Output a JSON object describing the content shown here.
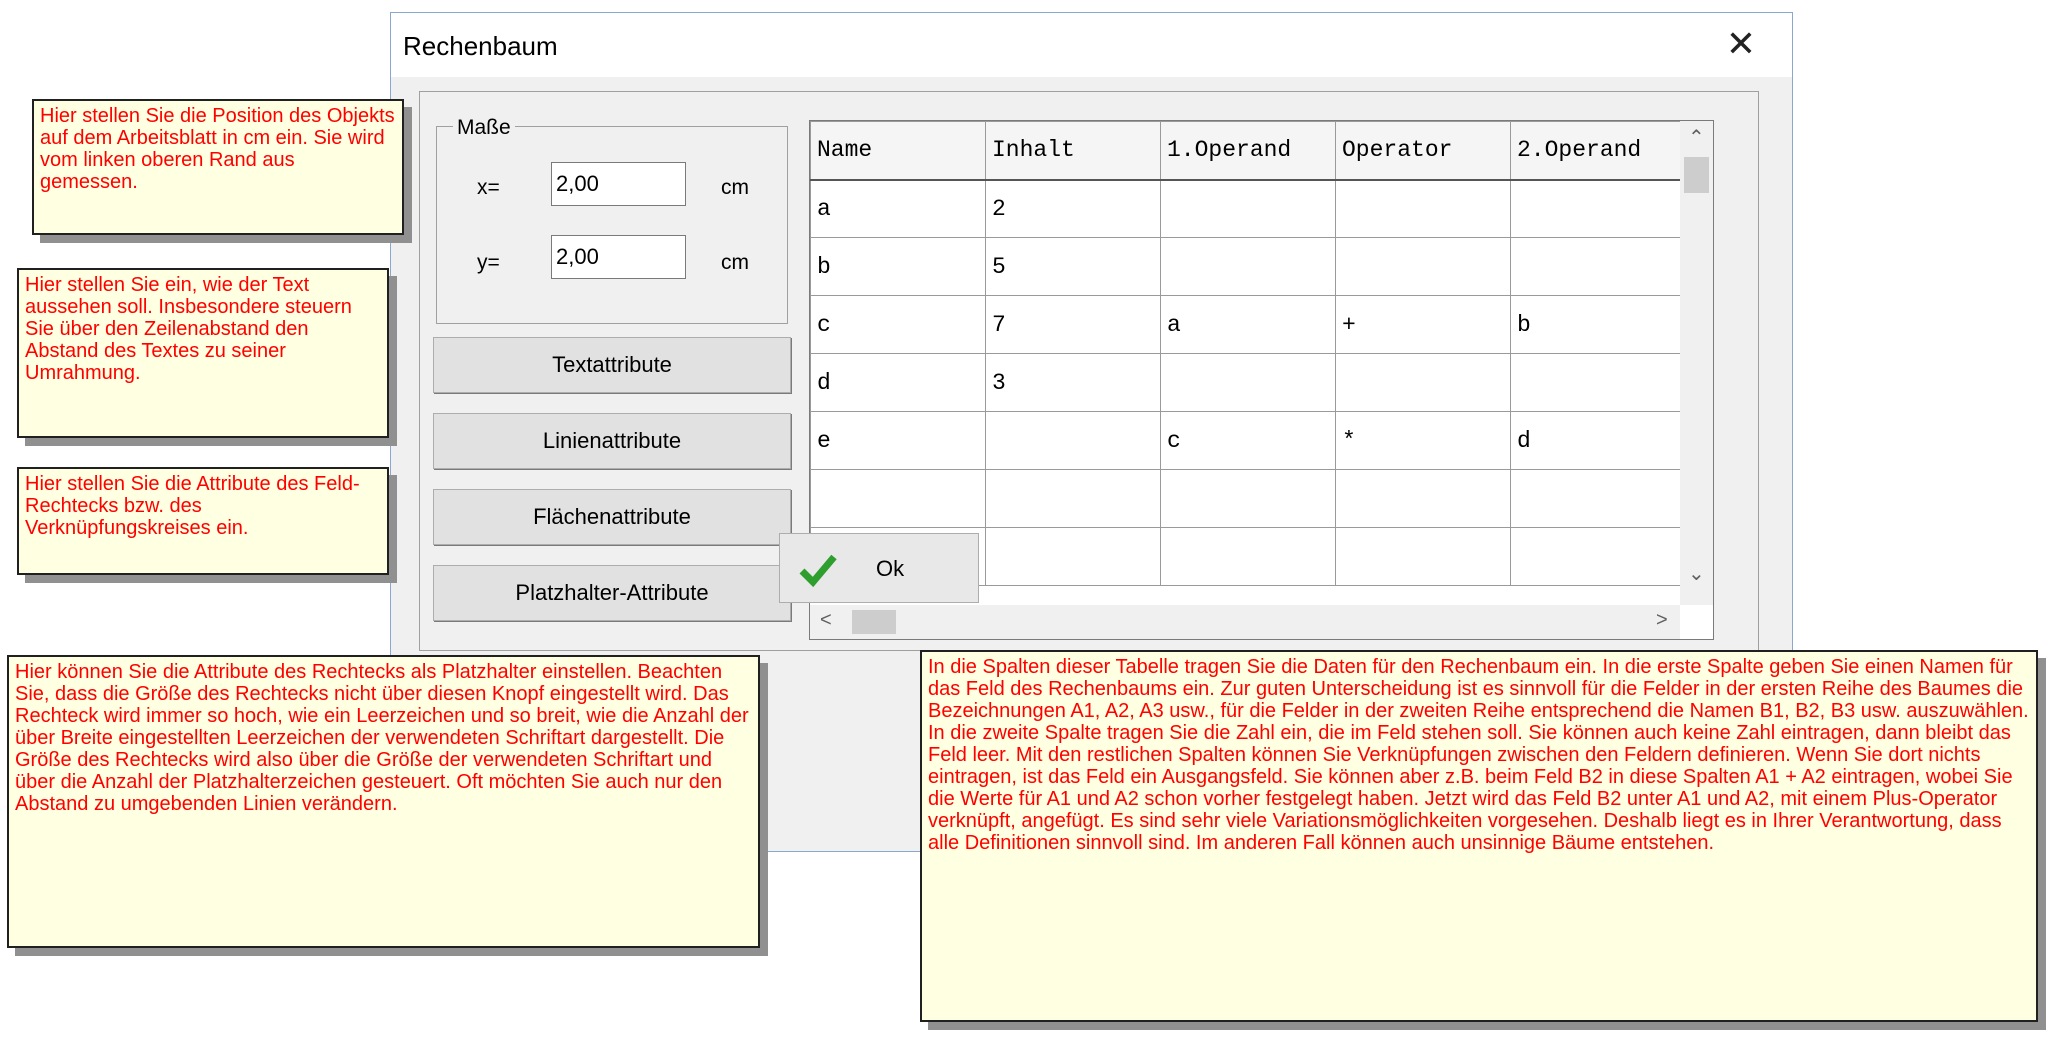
{
  "window": {
    "title": "Rechenbaum",
    "close_symbol": "✕"
  },
  "masse": {
    "group_label": "Maße",
    "x_label": "x=",
    "x_value": "2,00",
    "x_unit": "cm",
    "y_label": "y=",
    "y_value": "2,00",
    "y_unit": "cm"
  },
  "buttons": {
    "text": "Textattribute",
    "line": "Linienattribute",
    "area": "Flächenattribute",
    "placeholder": "Platzhalter-Attribute",
    "ok": "Ok"
  },
  "grid": {
    "headers": [
      "Name",
      "Inhalt",
      "1.Operand",
      "Operator",
      "2.Operand"
    ],
    "rows": [
      [
        "a",
        "2",
        "",
        "",
        ""
      ],
      [
        "b",
        "5",
        "",
        "",
        ""
      ],
      [
        "c",
        "7",
        "a",
        "+",
        "b"
      ],
      [
        "d",
        "3",
        "",
        "",
        ""
      ],
      [
        "e",
        "",
        "c",
        "*",
        "d"
      ],
      [
        "",
        "",
        "",
        "",
        ""
      ],
      [
        "",
        "",
        "",
        "",
        ""
      ]
    ]
  },
  "notes": {
    "position": "Hier stellen Sie die Position des Objekts auf dem Arbeitsblatt in cm ein. Sie wird vom linken oberen Rand aus gemessen.",
    "text": "Hier stellen Sie ein, wie der Text aussehen soll. Insbesondere steuern Sie über den Zeilenabstand den Abstand des Textes zu seiner Umrahmung.",
    "fill": "Hier stellen Sie die Attribute des Feld-Rechtecks bzw. des Verknüpfungskreises ein.",
    "placeholder": "Hier können Sie die Attribute des Rechtecks als Platzhalter einstellen. Beachten Sie, dass die Größe des Rechtecks nicht über diesen Knopf eingestellt wird. Das Rechteck wird immer so hoch, wie ein Leerzeichen und so breit, wie die Anzahl der über Breite eingestellten Leerzeichen der verwendeten Schriftart dargestellt. Die Größe des Rechtecks wird also über die Größe der verwendeten Schriftart und über die Anzahl der Platzhalterzeichen gesteuert. Oft möchten Sie auch nur den Abstand zu umgebenden Linien verändern.",
    "table": "In die Spalten dieser Tabelle tragen Sie die Daten für den Rechenbaum ein. In die erste Spalte geben Sie einen Namen für das Feld des Rechenbaums ein. Zur guten Unterscheidung ist es sinnvoll für die Felder in der ersten Reihe des Baumes die Bezeichnungen A1, A2, A3 usw., für die Felder in der zweiten Reihe entsprechend die Namen B1, B2, B3 usw. auszuwählen. In die zweite Spalte tragen Sie die Zahl ein, die im Feld stehen soll. Sie können auch keine Zahl eintragen, dann bleibt das Feld leer. Mit den restlichen Spalten können Sie Verknüpfungen zwischen den Feldern definieren. Wenn Sie dort nichts eintragen, ist das Feld ein Ausgangsfeld. Sie können aber z.B. beim Feld B2 in diese Spalten A1 + A2 eintragen, wobei Sie die Werte für A1 und A2 schon vorher festgelegt haben. Jetzt wird das Feld B2 unter A1 und A2, mit einem Plus-Operator verknüpft, angefügt. Es sind sehr viele Variationsmöglichkeiten vorgesehen. Deshalb liegt es in Ihrer Verantwortung, dass alle Definitionen sinnvoll sind. Im anderen Fall können auch unsinnige Bäume entstehen."
  },
  "icons": {
    "close": "close-icon",
    "ok": "checkmark-icon",
    "scroll_up": "chevron-up-icon",
    "scroll_down": "chevron-down-icon",
    "scroll_left": "chevron-left-icon",
    "scroll_right": "chevron-right-icon"
  },
  "colors": {
    "note_text": "#ff0000",
    "note_bg": "#ffffe1",
    "ok_check": "#2e9e2e"
  }
}
